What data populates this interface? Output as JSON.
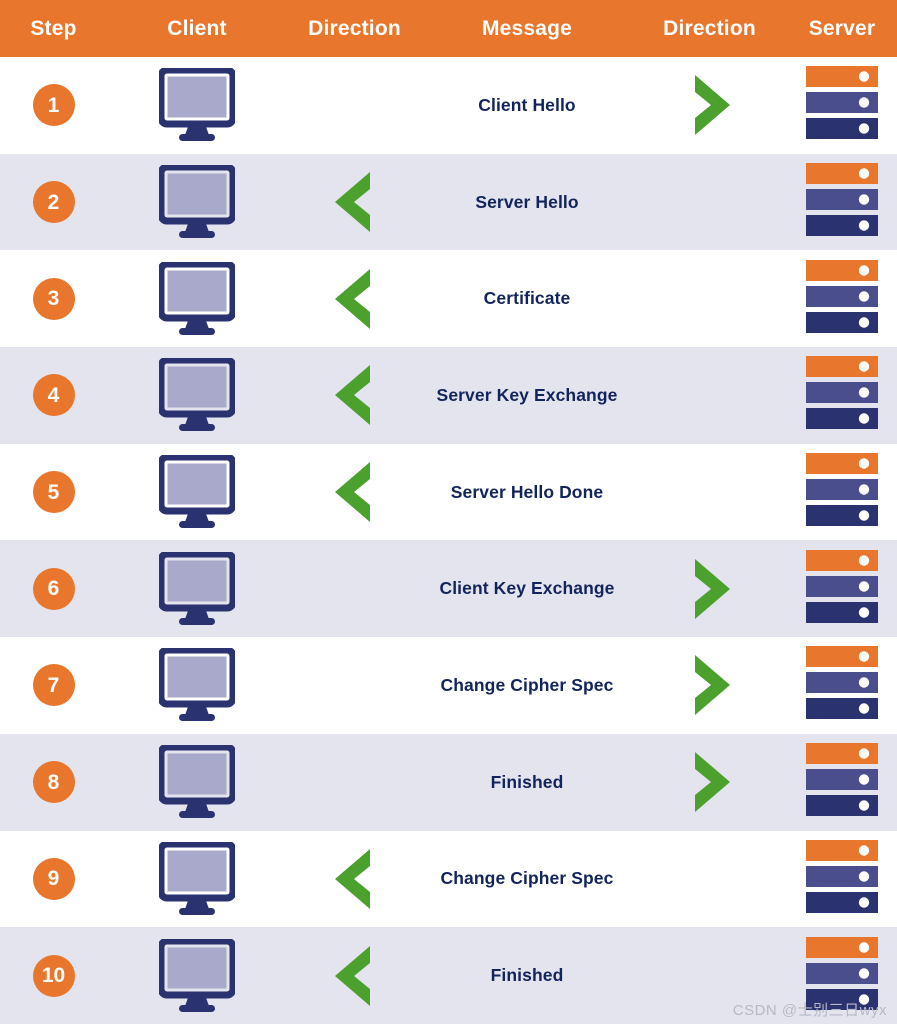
{
  "header": {
    "columns": [
      {
        "label": "Step",
        "key": "step"
      },
      {
        "label": "Client",
        "key": "client"
      },
      {
        "label": "Direction",
        "key": "direction_left"
      },
      {
        "label": "Message",
        "key": "message"
      },
      {
        "label": "Direction",
        "key": "direction_right"
      },
      {
        "label": "Server",
        "key": "server"
      }
    ]
  },
  "colors": {
    "orange": "#E8762C",
    "navy": "#2A3270",
    "screen": "#A9AACB",
    "green": "#4CA02E",
    "row_shaded": "#E4E4EE",
    "row_plain": "#FFFFFF",
    "message_text": "#12245C",
    "server_mid": "#4A4E8C",
    "server_dark": "#2A3270",
    "watermark_text": "#B9B9C6"
  },
  "icons": {
    "client": "monitor-icon",
    "server": "server-rack-icon",
    "arrow_right": "chevron-right-icon",
    "arrow_left": "chevron-left-icon"
  },
  "rows": [
    {
      "step": "1",
      "message": "Client Hello",
      "direction": "right",
      "client_icon": "monitor-icon",
      "server_icon": "server-rack-icon"
    },
    {
      "step": "2",
      "message": "Server Hello",
      "direction": "left",
      "client_icon": "monitor-icon",
      "server_icon": "server-rack-icon"
    },
    {
      "step": "3",
      "message": "Certificate",
      "direction": "left",
      "client_icon": "monitor-icon",
      "server_icon": "server-rack-icon"
    },
    {
      "step": "4",
      "message": "Server Key Exchange",
      "direction": "left",
      "client_icon": "monitor-icon",
      "server_icon": "server-rack-icon"
    },
    {
      "step": "5",
      "message": "Server Hello Done",
      "direction": "left",
      "client_icon": "monitor-icon",
      "server_icon": "server-rack-icon"
    },
    {
      "step": "6",
      "message": "Client Key Exchange",
      "direction": "right",
      "client_icon": "monitor-icon",
      "server_icon": "server-rack-icon"
    },
    {
      "step": "7",
      "message": "Change Cipher Spec",
      "direction": "right",
      "client_icon": "monitor-icon",
      "server_icon": "server-rack-icon"
    },
    {
      "step": "8",
      "message": "Finished",
      "direction": "right",
      "client_icon": "monitor-icon",
      "server_icon": "server-rack-icon"
    },
    {
      "step": "9",
      "message": "Change Cipher Spec",
      "direction": "left",
      "client_icon": "monitor-icon",
      "server_icon": "server-rack-icon"
    },
    {
      "step": "10",
      "message": "Finished",
      "direction": "left",
      "client_icon": "monitor-icon",
      "server_icon": "server-rack-icon"
    }
  ],
  "watermark": {
    "text": "CSDN @士别三日wyx"
  }
}
